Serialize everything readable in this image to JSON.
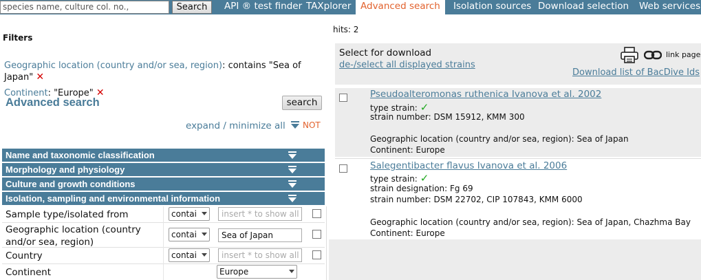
{
  "topbar": {
    "search_placeholder": "species name, culture col. no., sequence r",
    "search_button": "Search",
    "nav": [
      "API ® test finder",
      "TAXplorer",
      "Advanced search",
      "Isolation sources",
      "Download selection",
      "Web services"
    ],
    "active_nav": "Advanced search",
    "accent": "#4a7c99",
    "active_color": "#e2622d"
  },
  "filters": {
    "title": "Filters",
    "items": [
      {
        "field": "Geographic location (country and/or sea, region)",
        "op_text": ": contains \"Sea of Japan\""
      },
      {
        "field": "Continent",
        "op_text": ": \"Europe\""
      }
    ]
  },
  "advanced": {
    "title": "Advanced search",
    "search_button": "search",
    "expand": "expand / minimize all",
    "not_label": "NOT",
    "sections": [
      "Name and taxonomic classification",
      "Morphology and physiology",
      "Culture and growth conditions",
      "Isolation, sampling and environmental information"
    ],
    "fields": [
      {
        "label": "Sample type/isolated from",
        "op": "contai",
        "value": "insert * to show all",
        "filled": false
      },
      {
        "label": "Geographic location (country and/or sea, region)",
        "op": "contai",
        "value": "Sea of Japan",
        "filled": true
      },
      {
        "label": "Country",
        "op": "contai",
        "value": "insert * to show all",
        "filled": false
      },
      {
        "label": "Continent",
        "value": "Europe"
      }
    ]
  },
  "results": {
    "hits": "hits: 2",
    "select_for_download": "Select for download",
    "deselect_all": "de-/select all displayed strains",
    "link_page": "link page",
    "download_list": "Download list of BacDive Ids",
    "items": [
      {
        "title": "Pseudoalteromonas ruthenica Ivanova et al. 2002",
        "type_strain": "type strain:",
        "designation": "",
        "strain_number": "strain number: DSM 15912, KMM 300",
        "geo": "Geographic location (country and/or sea, region): Sea of Japan",
        "continent": "Continent: Europe"
      },
      {
        "title": "Salegentibacter flavus Ivanova et al. 2006",
        "type_strain": "type strain:",
        "designation": "strain designation: Fg 69",
        "strain_number": "strain number: DSM 22702, CIP 107843, KMM 6000",
        "geo": "Geographic location (country and/or sea, region): Sea of Japan, Chazhma Bay",
        "continent": "Continent: Europe"
      }
    ]
  }
}
